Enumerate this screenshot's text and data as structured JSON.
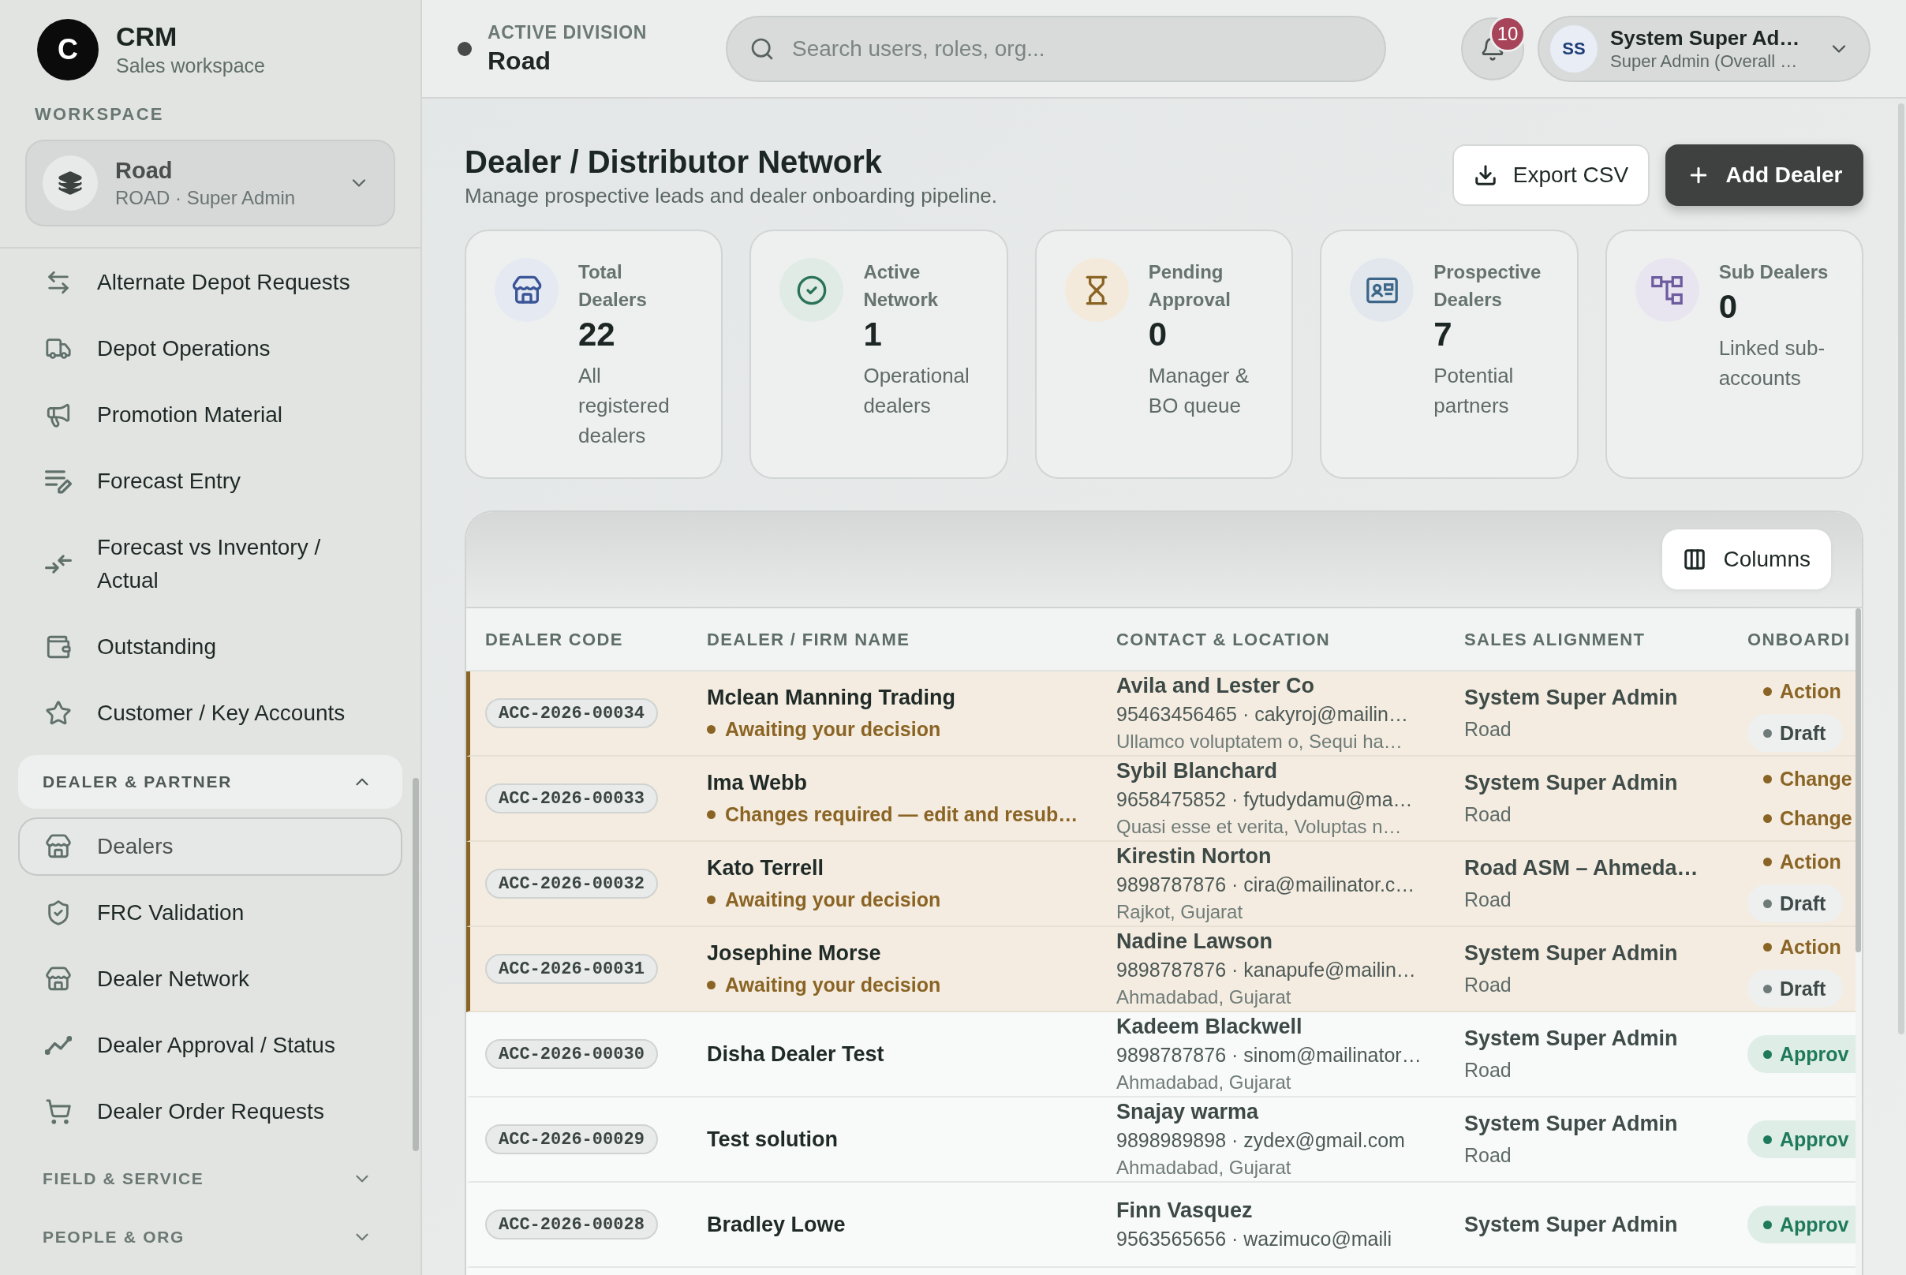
{
  "sidebar": {
    "brand": {
      "logo": "C",
      "title": "CRM",
      "subtitle": "Sales workspace"
    },
    "workspace_label": "WORKSPACE",
    "workspace": {
      "name": "Road",
      "detail": "ROAD · Super Admin"
    },
    "items": [
      {
        "label": "Alternate Depot Requests",
        "selected": false
      },
      {
        "label": "Depot Operations",
        "selected": false
      },
      {
        "label": "Promotion Material",
        "selected": false
      },
      {
        "label": "Forecast Entry",
        "selected": false
      },
      {
        "label": "Forecast vs Inventory / Actual",
        "selected": false
      },
      {
        "label": "Outstanding",
        "selected": false
      },
      {
        "label": "Customer / Key Accounts",
        "selected": false
      }
    ],
    "sections": [
      {
        "title": "DEALER & PARTNER",
        "expanded": true,
        "items": [
          {
            "label": "Dealers",
            "selected": true
          },
          {
            "label": "FRC Validation",
            "selected": false
          },
          {
            "label": "Dealer Network",
            "selected": false
          },
          {
            "label": "Dealer Approval / Status",
            "selected": false
          },
          {
            "label": "Dealer Order Requests",
            "selected": false
          }
        ]
      },
      {
        "title": "FIELD & SERVICE",
        "expanded": false
      },
      {
        "title": "PEOPLE & ORG",
        "expanded": false
      }
    ]
  },
  "header": {
    "division_label": "ACTIVE DIVISION",
    "division": "Road",
    "search": {
      "placeholder": "Search users, roles, org..."
    },
    "notifications": "10",
    "user": {
      "initials": "SS",
      "name": "System Super Ad…",
      "role": "Super Admin (Overall …"
    }
  },
  "page": {
    "title": "Dealer / Distributor Network",
    "subtitle": "Manage prospective leads and dealer onboarding pipeline.",
    "buttons": [
      {
        "label": "Export CSV",
        "kind": "export"
      },
      {
        "label": "Add Dealer",
        "kind": "add"
      }
    ]
  },
  "stats": [
    {
      "label": "Total Dealers",
      "value": "22",
      "caption": "All registered dealers"
    },
    {
      "label": "Active Network",
      "value": "1",
      "caption": "Operational dealers"
    },
    {
      "label": "Pending Approval",
      "value": "0",
      "caption": "Manager & BO queue"
    },
    {
      "label": "Prospective Dealers",
      "value": "7",
      "caption": "Potential partners"
    },
    {
      "label": "Sub Dealers",
      "value": "0",
      "caption": "Linked sub-accounts"
    }
  ],
  "table": {
    "toolbar_button": "Columns",
    "columns": [
      "DEALER CODE",
      "DEALER / FIRM NAME",
      "CONTACT & LOCATION",
      "SALES ALIGNMENT",
      "ONBOARDI"
    ],
    "rows": [
      {
        "code": "ACC-2026-00034",
        "firm": "Mclean Manning Trading",
        "status": "Awaiting your decision",
        "contact_name": "Avila and Lester Co",
        "contact_line": "95463456465 · cakyroj@mailin…",
        "location": "Ullamco voluptatem o, Sequi ha…",
        "sales_owner": "System Super Admin",
        "sales_area": "Road",
        "onboarding": [
          {
            "label": "Action",
            "kind": "pending"
          },
          {
            "label": "Draft",
            "kind": "draft"
          }
        ],
        "flagged": true
      },
      {
        "code": "ACC-2026-00033",
        "firm": "Ima Webb",
        "status": "Changes required — edit and resub…",
        "contact_name": "Sybil Blanchard",
        "contact_line": "9658475852 · fytudydamu@ma…",
        "location": "Quasi esse et verita, Voluptas n…",
        "sales_owner": "System Super Admin",
        "sales_area": "Road",
        "onboarding": [
          {
            "label": "Change",
            "kind": "pending"
          },
          {
            "label": "Change",
            "kind": "pending"
          }
        ],
        "flagged": true
      },
      {
        "code": "ACC-2026-00032",
        "firm": "Kato Terrell",
        "status": "Awaiting your decision",
        "contact_name": "Kirestin Norton",
        "contact_line": "9898787876 · cira@mailinator.c…",
        "location": "Rajkot, Gujarat",
        "sales_owner": "Road ASM – Ahmeda…",
        "sales_area": "Road",
        "onboarding": [
          {
            "label": "Action",
            "kind": "pending"
          },
          {
            "label": "Draft",
            "kind": "draft"
          }
        ],
        "flagged": true
      },
      {
        "code": "ACC-2026-00031",
        "firm": "Josephine Morse",
        "status": "Awaiting your decision",
        "contact_name": "Nadine Lawson",
        "contact_line": "9898787876 · kanapufe@mailin…",
        "location": "Ahmadabad, Gujarat",
        "sales_owner": "System Super Admin",
        "sales_area": "Road",
        "onboarding": [
          {
            "label": "Action",
            "kind": "pending"
          },
          {
            "label": "Draft",
            "kind": "draft"
          }
        ],
        "flagged": true
      },
      {
        "code": "ACC-2026-00030",
        "firm": "Disha Dealer Test",
        "contact_name": "Kadeem Blackwell",
        "contact_line": "9898787876 · sinom@mailinator…",
        "location": "Ahmadabad, Gujarat",
        "sales_owner": "System Super Admin",
        "sales_area": "Road",
        "onboarding": [
          {
            "label": "Approv",
            "kind": "approved"
          }
        ],
        "flagged": false
      },
      {
        "code": "ACC-2026-00029",
        "firm": "Test solution",
        "contact_name": "Snajay warma",
        "contact_line": "9898989898 · zydex@gmail.com",
        "location": "Ahmadabad, Gujarat",
        "sales_owner": "System Super Admin",
        "sales_area": "Road",
        "onboarding": [
          {
            "label": "Approv",
            "kind": "approved"
          }
        ],
        "flagged": false
      },
      {
        "code": "ACC-2026-00028",
        "firm": "Bradley Lowe",
        "contact_name": "Finn Vasquez",
        "contact_line": "9563565656 · wazimuco@maili",
        "sales_owner": "System Super Admin",
        "onboarding": [
          {
            "label": "Approv",
            "kind": "approved"
          }
        ],
        "flagged": false
      }
    ]
  }
}
